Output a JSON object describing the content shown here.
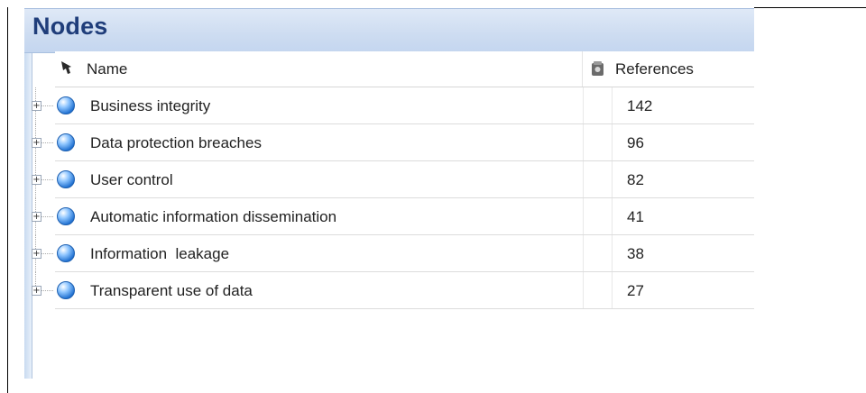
{
  "panel": {
    "title": "Nodes"
  },
  "columns": {
    "name_label": "Name",
    "references_label": "References",
    "name_icon": "pushpin-icon",
    "references_icon": "references-icon"
  },
  "nodes": [
    {
      "name": "Business integrity",
      "references": "142"
    },
    {
      "name": "Data protection breaches",
      "references": "96"
    },
    {
      "name": "User control",
      "references": "82"
    },
    {
      "name": "Automatic information dissemination",
      "references": "41"
    },
    {
      "name": "Information  leakage",
      "references": "38"
    },
    {
      "name": "Transparent use of data",
      "references": "27"
    }
  ],
  "colors": {
    "header_title": "#1f3d7a",
    "header_bg": "#cddcf1",
    "node_icon": "#3a8ee6"
  }
}
